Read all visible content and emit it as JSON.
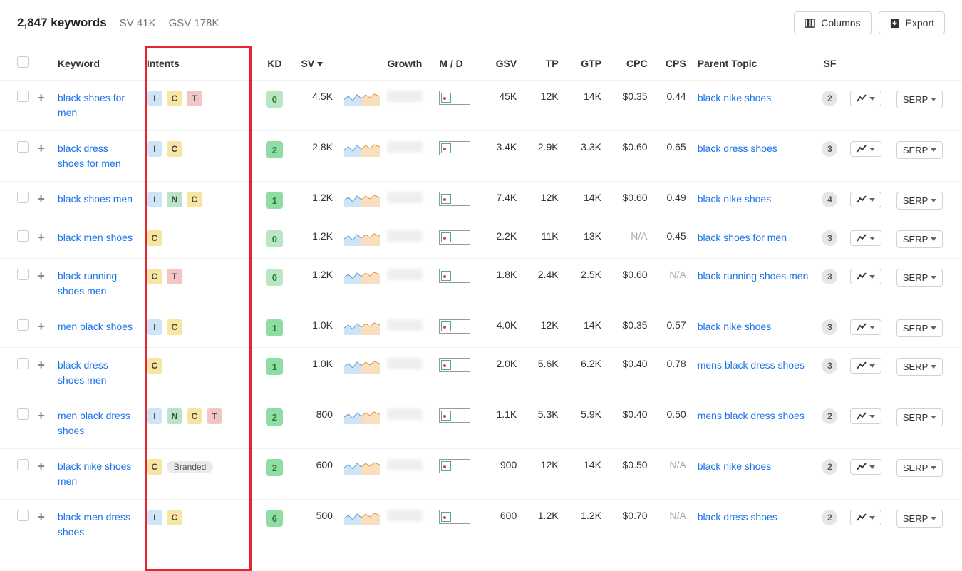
{
  "topbar": {
    "count": "2,847 keywords",
    "sv": "SV 41K",
    "gsv": "GSV 178K",
    "columns_btn": "Columns",
    "export_btn": "Export"
  },
  "headers": {
    "keyword": "Keyword",
    "intents": "Intents",
    "kd": "KD",
    "sv": "SV",
    "growth": "Growth",
    "md": "M / D",
    "gsv": "GSV",
    "tp": "TP",
    "gtp": "GTP",
    "cpc": "CPC",
    "cps": "CPS",
    "parent": "Parent Topic",
    "sf": "SF"
  },
  "serp_label": "SERP",
  "rows": [
    {
      "keyword": "black shoes for men",
      "intents": [
        "I",
        "C",
        "T"
      ],
      "kd": "0",
      "kd_class": "kd-light",
      "sv": "4.5K",
      "gsv": "45K",
      "tp": "12K",
      "gtp": "14K",
      "cpc": "$0.35",
      "cps": "0.44",
      "parent": "black nike shoes",
      "sf": "2"
    },
    {
      "keyword": "black dress shoes for men",
      "intents": [
        "I",
        "C"
      ],
      "kd": "2",
      "kd_class": "kd-mid",
      "sv": "2.8K",
      "gsv": "3.4K",
      "tp": "2.9K",
      "gtp": "3.3K",
      "cpc": "$0.60",
      "cps": "0.65",
      "parent": "black dress shoes",
      "sf": "3"
    },
    {
      "keyword": "black shoes men",
      "intents": [
        "I",
        "N",
        "C"
      ],
      "kd": "1",
      "kd_class": "kd-mid",
      "sv": "1.2K",
      "gsv": "7.4K",
      "tp": "12K",
      "gtp": "14K",
      "cpc": "$0.60",
      "cps": "0.49",
      "parent": "black nike shoes",
      "sf": "4"
    },
    {
      "keyword": "black men shoes",
      "intents": [
        "C"
      ],
      "kd": "0",
      "kd_class": "kd-light",
      "sv": "1.2K",
      "gsv": "2.2K",
      "tp": "11K",
      "gtp": "13K",
      "cpc": "N/A",
      "cps": "0.45",
      "parent": "black shoes for men",
      "sf": "3"
    },
    {
      "keyword": "black running shoes men",
      "intents": [
        "C",
        "T"
      ],
      "kd": "0",
      "kd_class": "kd-light",
      "sv": "1.2K",
      "gsv": "1.8K",
      "tp": "2.4K",
      "gtp": "2.5K",
      "cpc": "$0.60",
      "cps": "N/A",
      "parent": "black running shoes men",
      "sf": "3"
    },
    {
      "keyword": "men black shoes",
      "intents": [
        "I",
        "C"
      ],
      "kd": "1",
      "kd_class": "kd-mid",
      "sv": "1.0K",
      "gsv": "4.0K",
      "tp": "12K",
      "gtp": "14K",
      "cpc": "$0.35",
      "cps": "0.57",
      "parent": "black nike shoes",
      "sf": "3"
    },
    {
      "keyword": "black dress shoes men",
      "intents": [
        "C"
      ],
      "kd": "1",
      "kd_class": "kd-mid",
      "sv": "1.0K",
      "gsv": "2.0K",
      "tp": "5.6K",
      "gtp": "6.2K",
      "cpc": "$0.40",
      "cps": "0.78",
      "parent": "mens black dress shoes",
      "sf": "3"
    },
    {
      "keyword": "men black dress shoes",
      "intents": [
        "I",
        "N",
        "C",
        "T"
      ],
      "kd": "2",
      "kd_class": "kd-mid",
      "sv": "800",
      "gsv": "1.1K",
      "tp": "5.3K",
      "gtp": "5.9K",
      "cpc": "$0.40",
      "cps": "0.50",
      "parent": "mens black dress shoes",
      "sf": "2"
    },
    {
      "keyword": "black nike shoes men",
      "intents": [
        "C"
      ],
      "branded": "Branded",
      "kd": "2",
      "kd_class": "kd-mid",
      "sv": "600",
      "gsv": "900",
      "tp": "12K",
      "gtp": "14K",
      "cpc": "$0.50",
      "cps": "N/A",
      "parent": "black nike shoes",
      "sf": "2"
    },
    {
      "keyword": "black men dress shoes",
      "intents": [
        "I",
        "C"
      ],
      "kd": "6",
      "kd_class": "kd-mid",
      "sv": "500",
      "gsv": "600",
      "tp": "1.2K",
      "gtp": "1.2K",
      "cpc": "$0.70",
      "cps": "N/A",
      "parent": "black dress shoes",
      "sf": "2"
    }
  ]
}
